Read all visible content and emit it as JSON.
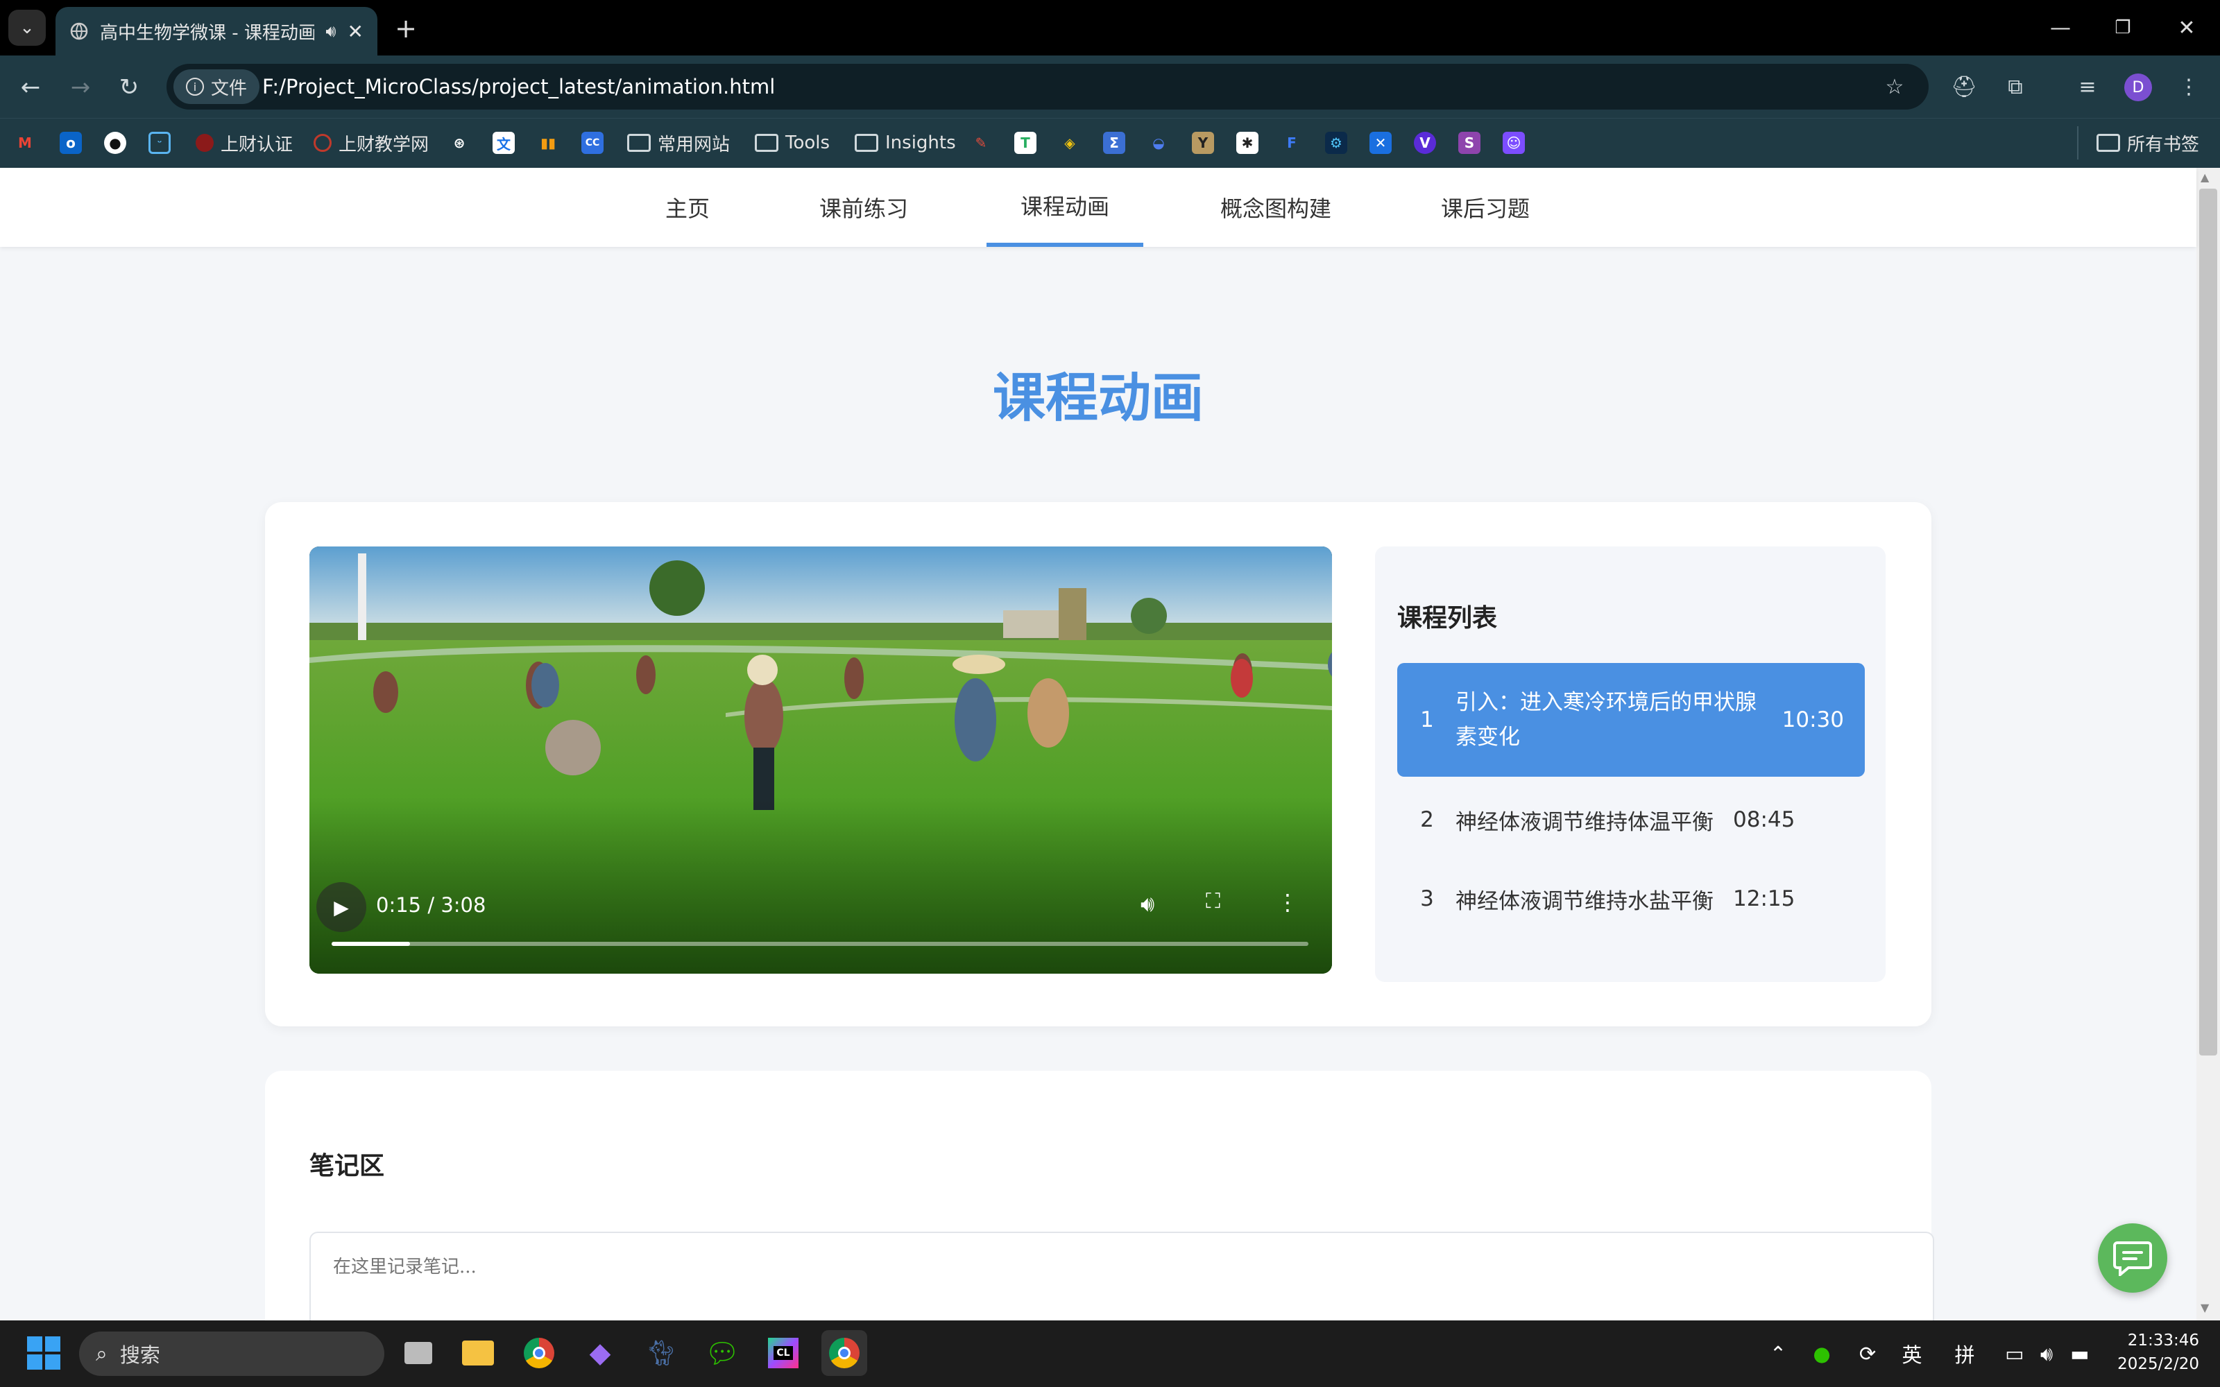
{
  "browser": {
    "tab_title": "高中生物学微课 - 课程动画",
    "url": "F:/Project_MicroClass/project_latest/animation.html",
    "file_chip": "文件",
    "bookmarks": [
      {
        "label": "上财认证",
        "icon": "red-circle-icon"
      },
      {
        "label": "上财教学网",
        "icon": "red-ring-icon"
      },
      {
        "label": "常用网站",
        "icon": "folder-icon"
      },
      {
        "label": "Tools",
        "icon": "folder-icon"
      },
      {
        "label": "Insights",
        "icon": "folder-icon"
      }
    ],
    "all_bookmarks": "所有书签",
    "profile_initial": "D"
  },
  "nav": {
    "items": [
      "主页",
      "课前练习",
      "课程动画",
      "概念图构建",
      "课后习题"
    ],
    "active": "课程动画"
  },
  "page": {
    "title": "课程动画"
  },
  "video": {
    "time": "0:15 / 3:08",
    "progress": 0.08
  },
  "playlist": {
    "title": "课程列表",
    "items": [
      {
        "num": "1",
        "title": "引入：进入寒冷环境后的甲状腺素变化",
        "duration": "10:30",
        "active": true
      },
      {
        "num": "2",
        "title": "神经体液调节维持体温平衡",
        "duration": "08:45",
        "active": false
      },
      {
        "num": "3",
        "title": "神经体液调节维持水盐平衡",
        "duration": "12:15",
        "active": false
      }
    ]
  },
  "notes": {
    "title": "笔记区",
    "placeholder": "在这里记录笔记..."
  },
  "taskbar": {
    "search": "搜索",
    "ime_lang": "英",
    "ime_mode": "拼",
    "time": "21:33:46",
    "date": "2025/2/20"
  },
  "colors": {
    "accent": "#4a90e2",
    "chat": "#5cb85c",
    "chrome_bg": "#1f3a44"
  }
}
